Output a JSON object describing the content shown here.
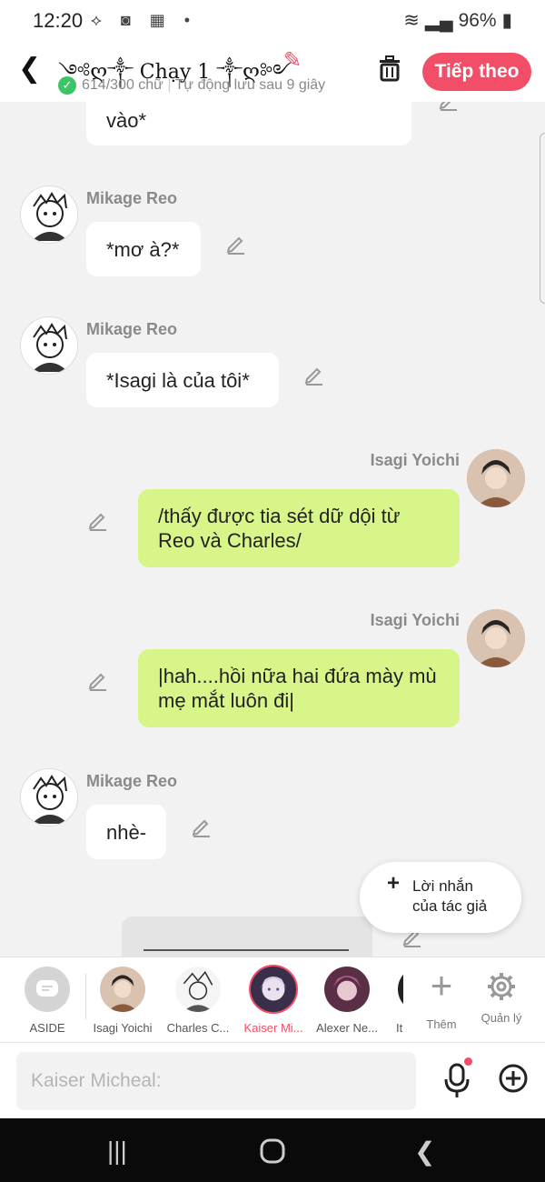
{
  "status": {
    "time": "12:20",
    "battery": "96%"
  },
  "header": {
    "title": "༺ღ༒ Chạy 1 ༒ღ༻",
    "word_count": "614/300 chữ",
    "autosave": "Tự động lưu sau 9 giây",
    "next_label": "Tiếp theo"
  },
  "messages": [
    {
      "text": "vào*",
      "side": "left"
    },
    {
      "sender": "Mikage Reo",
      "text": "*mơ à?*",
      "side": "left"
    },
    {
      "sender": "Mikage Reo",
      "text": "*Isagi là của tôi*",
      "side": "left"
    },
    {
      "sender": "Isagi Yoichi",
      "text": "/thấy được tia sét dữ dội từ Reo và Charles/",
      "side": "right"
    },
    {
      "sender": "Isagi Yoichi",
      "text": "|hah....hồi nữa hai đứa mày mù mẹ mắt luôn đi|",
      "side": "right"
    },
    {
      "sender": "Mikage Reo",
      "text": "nhè-",
      "side": "left"
    }
  ],
  "author_note": {
    "line1": "Lời nhắn",
    "line2": "của tác giả"
  },
  "characters": [
    {
      "label": "ASIDE"
    },
    {
      "label": "Isagi Yoichi"
    },
    {
      "label": "Charles C..."
    },
    {
      "label": "Kaiser Mi..."
    },
    {
      "label": "Alexer Ne..."
    },
    {
      "label": "It"
    }
  ],
  "actions": {
    "add_label": "Thêm",
    "manage_label": "Quản lý"
  },
  "input": {
    "placeholder": "Kaiser Micheal:"
  },
  "colors": {
    "accent": "#f24e68",
    "green_bubble": "#d8f58a",
    "check": "#3cc467"
  }
}
